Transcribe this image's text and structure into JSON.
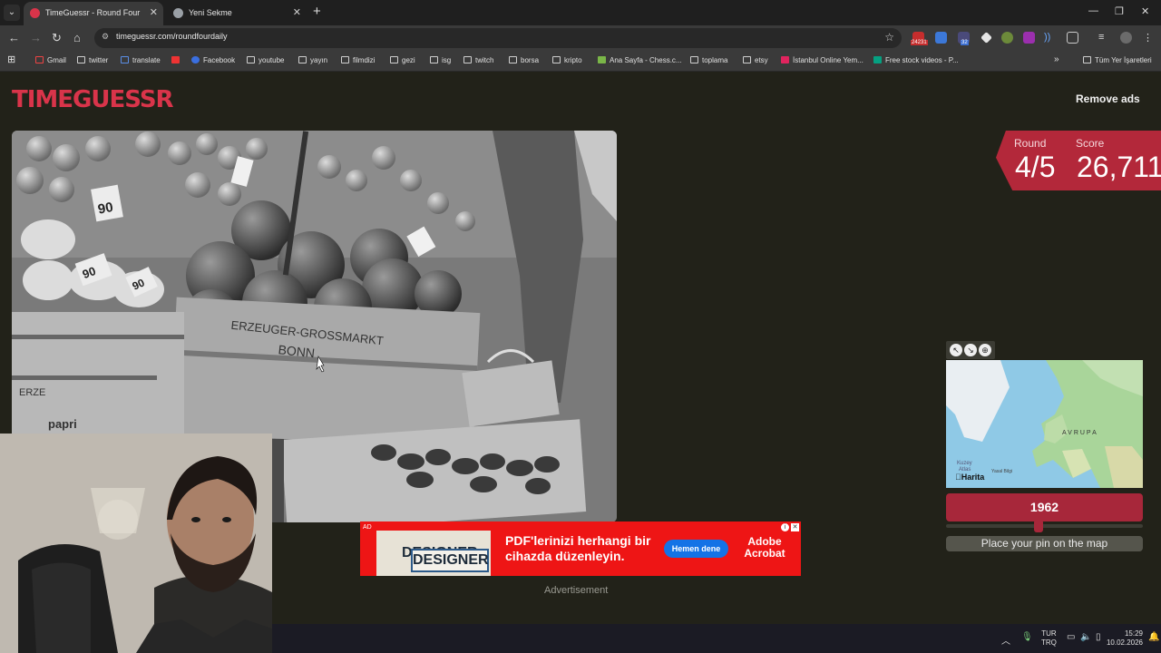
{
  "tabs": [
    {
      "title": "TimeGuessr - Round Four",
      "active": true
    },
    {
      "title": "Yeni Sekme",
      "active": false
    }
  ],
  "toolbar": {
    "url": "timeguessr.com/roundfourdaily"
  },
  "bookmarks": [
    "Gmail",
    "twitter",
    "translate",
    "Facebook",
    "youtube",
    "yayın",
    "filmdizi",
    "gezi",
    "isg",
    "twitch",
    "borsa",
    "kripto",
    "Ana Sayfa - Chess.c...",
    "toplama",
    "etsy",
    "İstanbul Online Yem...",
    "Free stock videos - P...",
    "Tüm Yer İşaretleri"
  ],
  "extensions": {
    "badge_1": "24231",
    "badge_2": "32"
  },
  "header": {
    "logo": "TIMEGUESSR",
    "remove_ads": "Remove ads"
  },
  "photo": {
    "crate_text_1": "ERZEUGER-GROSSMARKT",
    "crate_text_2": "BONN",
    "price_tags": [
      "90",
      "90",
      "90"
    ],
    "side_text": "ERZE",
    "side_text_2": "papri"
  },
  "round_panel": {
    "round_label": "Round",
    "round_value": "4/5",
    "score_label": "Score",
    "score_value": "26,711"
  },
  "map": {
    "region_label": "AVRUPA",
    "ocean_label_1": "Kuzey",
    "ocean_label_2": "Atlas",
    "attribution": "Harita",
    "legal": "Yasal Bilgi"
  },
  "guess": {
    "year": "1962",
    "slider_fraction": 0.47,
    "pin_prompt": "Place your pin on the map"
  },
  "ad": {
    "tag": "AD",
    "designer": "DESIGNER",
    "headline": "PDF'lerinizi herhangi bir cihazda düzenleyin.",
    "cta": "Hemen dene",
    "brand_line1": "Adobe",
    "brand_line2": "Acrobat",
    "caption": "Advertisement"
  },
  "taskbar": {
    "lang_1": "TUR",
    "lang_2": "TRQ",
    "time": "15:29",
    "date": "10.02.2026"
  }
}
